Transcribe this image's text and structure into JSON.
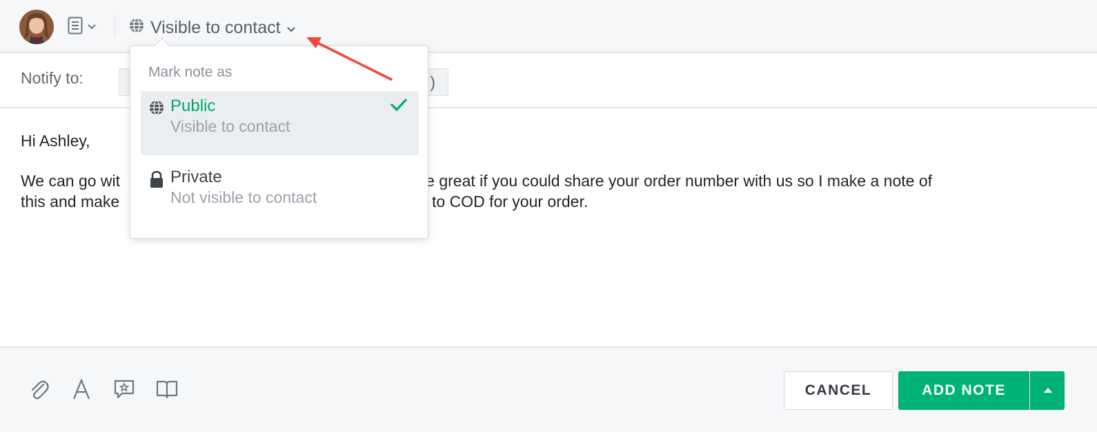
{
  "header": {
    "visibility_label": "Visible to contact"
  },
  "notify": {
    "label": "Notify to:",
    "field_tail": ")"
  },
  "editor": {
    "greeting": "Hi Ashley,",
    "line1_start": "We can go wit",
    "line1_end": "ery. It'd be great if you could share your order number with us so I make a note of",
    "line2_start": "this and make",
    "line2_end": "to COD for your order."
  },
  "dropdown": {
    "heading": "Mark note as",
    "options": [
      {
        "title": "Public",
        "desc": "Visible to contact",
        "icon": "globe-icon",
        "selected": true
      },
      {
        "title": "Private",
        "desc": "Not visible to contact",
        "icon": "lock-icon",
        "selected": false
      }
    ]
  },
  "footer": {
    "tools": [
      "paperclip-icon",
      "text-format-icon",
      "canned-response-icon",
      "book-icon"
    ],
    "cancel_label": "CANCEL",
    "add_label": "ADD NOTE"
  },
  "colors": {
    "accent_green": "#00b374",
    "arrow_red": "#f0483e"
  }
}
